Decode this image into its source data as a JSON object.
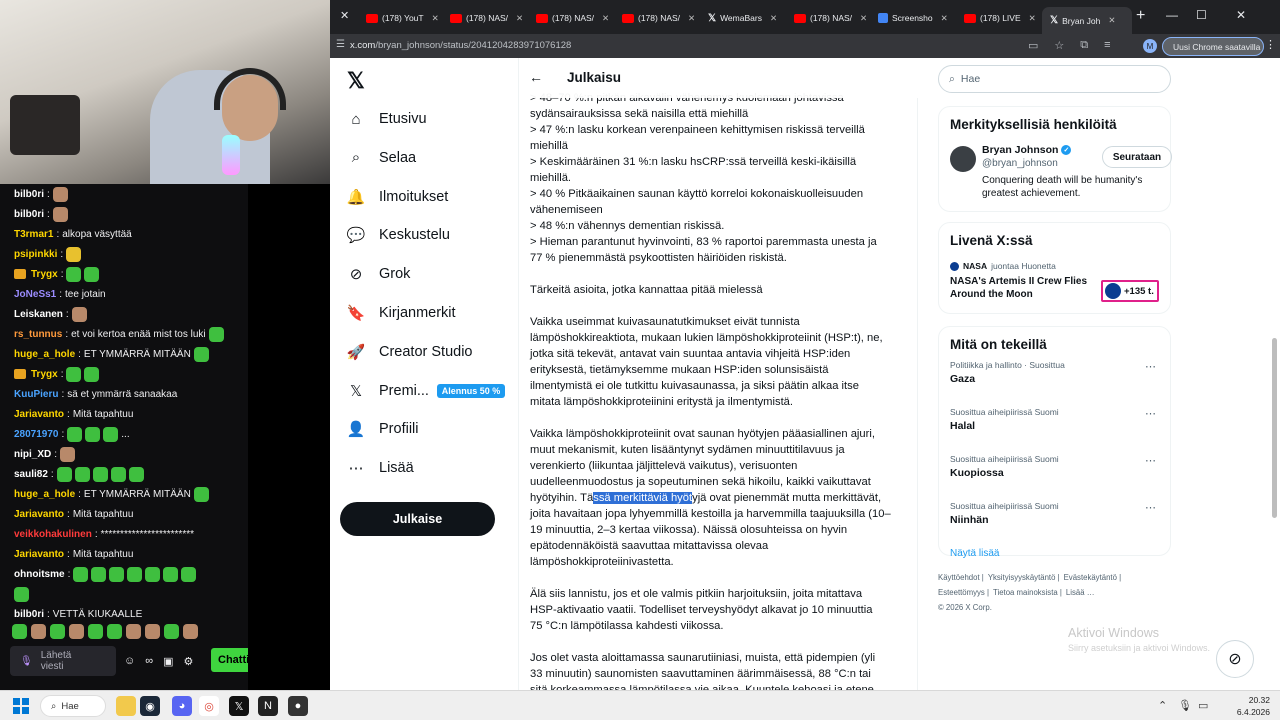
{
  "tabs": [
    {
      "label": "(178) YouT",
      "kind": "yt"
    },
    {
      "label": "(178) NAS/",
      "kind": "yt"
    },
    {
      "label": "(178) NAS/",
      "kind": "yt"
    },
    {
      "label": "(178) NAS/",
      "kind": "yt"
    },
    {
      "label": "WemaBars",
      "kind": "x"
    },
    {
      "label": "(178) NAS/",
      "kind": "yt"
    },
    {
      "label": "Screensho",
      "kind": "doc"
    },
    {
      "label": "(178) LIVE",
      "kind": "yt"
    },
    {
      "label": "Bryan Joh",
      "kind": "x",
      "active": true
    }
  ],
  "address": {
    "host": "x.com",
    "path": "/bryan_johnson/status/2041204283971076128"
  },
  "chrome_update": "Uusi Chrome saatavilla",
  "nav": {
    "logo": "𝕏",
    "items": [
      {
        "label": "Etusivu",
        "icon": "⌂"
      },
      {
        "label": "Selaa",
        "icon": "⌕"
      },
      {
        "label": "Ilmoitukset",
        "icon": "🔔"
      },
      {
        "label": "Keskustelu",
        "icon": "💬"
      },
      {
        "label": "Grok",
        "icon": "⊘"
      },
      {
        "label": "Kirjanmerkit",
        "icon": "🔖"
      },
      {
        "label": "Creator Studio",
        "icon": "🚀"
      },
      {
        "label": "Premi...",
        "icon": "𝕏"
      },
      {
        "label": "Profiili",
        "icon": "👤"
      },
      {
        "label": "Lisää",
        "icon": "⋯"
      }
    ],
    "promo": "Alennus 50 %",
    "post_button": "Julkaise"
  },
  "main": {
    "title": "Julkaisu",
    "lines": [
      "> 48–70 %:n pitkän aikavälin vähenemys kuolemaan johtavissa",
      "sydänsairauksissa sekä naisilla että miehillä",
      "> 47 %:n lasku korkean verenpaineen kehittymisen riskissä terveillä",
      "miehillä",
      "> Keskimääräinen 31 %:n lasku hsCRP:ssä terveillä keski-ikäisillä",
      "miehillä.",
      "> 40 % Pitkäaikainen saunan käyttö korreloi kokonaiskuolleisuuden",
      "vähenemiseen",
      "> 48 %:n vähennys dementian riskissä.",
      "> Hieman parantunut hyvinvointi, 83 % raportoi paremmasta unesta ja",
      "77 % pienemmästä psykoottisten häiriöiden riskistä.",
      "",
      "Tärkeitä asioita, jotka kannattaa pitää mielessä",
      "",
      "Vaikka useimmat kuivasaunatutkimukset eivät tunnista",
      "lämpöshokkireaktiota, mukaan lukien lämpöshokkiproteiinit (HSP:t), ne,",
      "jotka sitä tekevät, antavat vain suuntaa antavia vihjeitä HSP:iden",
      "erityksestä, tietämyksemme mukaan HSP:iden solunsisäistä",
      "ilmentymistä ei ole tutkittu kuivasaunassa, ja siksi päätin alkaa itse",
      "mitata lämpöshokkiproteiinini eritystä ja ilmentymistä.",
      "",
      "Vaikka lämpöshokkiproteiinit ovat saunan hyötyjen pääasiallinen ajuri,",
      "muut mekanismit, kuten lisääntynyt sydämen minuuttitilavuus ja",
      "verenkierto (liikuntaa jäljittelevä vaikutus), verisuonten",
      "uudelleenmuodostus ja sopeutuminen sekä hikoilu, kaikki vaikuttavat"
    ],
    "hl_pre": "hyötyihin. Tä",
    "hl_text": "ssä merkittäviä hyöt",
    "hl_post": "yjä ovat pienemmät mutta merkittävät,",
    "lines2": [
      "joita havaitaan jopa lyhyemmillä kestoilla ja harvemmilla taajuuksilla (10–",
      "19 minuuttia, 2–3 kertaa viikossa). Näissä olosuhteissa on hyvin",
      "epätodennäköistä saavuttaa mitattavissa olevaa",
      "lämpöshokkiproteiinivastetta.",
      "",
      "Älä siis lannistu, jos et ole valmis pitkiin harjoituksiin, joita mitattava",
      "HSP-aktivaatio vaatii. Todelliset terveyshyödyt alkavat jo 10 minuuttia",
      "75 °C:n lämpötilassa kahdesti viikossa.",
      "",
      "Jos olet vasta aloittamassa saunarutiiniasi, muista, että pidempien (yli",
      "33 minuutin) saunomisten saavuttaminen äärimmäisessä, 88 °C:n tai",
      "sitä korkeammassa lämpötilassa vie aikaa. Kuuntele kehoasi ja etene"
    ]
  },
  "right": {
    "search_placeholder": "Hae",
    "people_title": "Merkityksellisiä henkilöitä",
    "person": {
      "name": "Bryan Johnson",
      "handle": "@bryan_johnson",
      "bio": "Conquering death will be humanity's greatest achievement.",
      "follow": "Seurataan"
    },
    "live_title": "Livenä X:ssä",
    "live": {
      "account": "NASA",
      "status": "juontaa Huonetta",
      "title": "NASA's Artemis II Crew Flies Around the Moon",
      "count": "+135 t."
    },
    "trends_title": "Mitä on tekeillä",
    "trends": [
      {
        "meta": "Politiikka ja hallinto · Suosittua",
        "name": "Gaza"
      },
      {
        "meta": "Suosittua aiheipiirissä Suomi",
        "name": "Halal"
      },
      {
        "meta": "Suosittua aiheipiirissä Suomi",
        "name": "Kuopiossa"
      },
      {
        "meta": "Suosittua aiheipiirissä Suomi",
        "name": "Niinhän"
      }
    ],
    "show_more": "Näytä lisää",
    "footer": [
      "Käyttöehdot |",
      "Yksityisyyskäytäntö |",
      "Evästekäytäntö |",
      "Esteettömyys |",
      "Tietoa mainoksista |",
      "Lisää …",
      "© 2026 X Corp."
    ]
  },
  "activate": {
    "title": "Aktivoi Windows",
    "sub": "Siirry asetuksiin ja aktivoi Windows."
  },
  "chat": {
    "messages": [
      {
        "user": "bilb0ri",
        "color": "#ffffff",
        "text": "",
        "emotes": [
          "face"
        ]
      },
      {
        "user": "bilb0ri",
        "color": "#ffffff",
        "text": "",
        "emotes": [
          "face"
        ]
      },
      {
        "user": "T3rmar1",
        "color": "#ffd700",
        "text": "alkopa väsyttää",
        "emotes": []
      },
      {
        "user": "psipinkki",
        "color": "#ffd700",
        "text": "",
        "emotes": [
          "yellow"
        ]
      },
      {
        "user": "Trygx",
        "color": "#ffd700",
        "text": "",
        "emotes": [
          "green",
          "green"
        ],
        "badge": true
      },
      {
        "user": "JoNeSs1",
        "color": "#9b8cff",
        "text": "tee jotain",
        "emotes": []
      },
      {
        "user": "Leiskanen",
        "color": "#ffffff",
        "text": "",
        "emotes": [
          "face"
        ]
      },
      {
        "user": "rs_tunnus",
        "color": "#ff9a3c",
        "text": "et voi kertoa enää mist tos luki",
        "emotes": [
          "green"
        ]
      },
      {
        "user": "huge_a_hole",
        "color": "#ffd700",
        "text": "ET YMMÄRRÄ MITÄÄN",
        "emotes": [
          "green"
        ]
      },
      {
        "user": "Trygx",
        "color": "#ffd700",
        "text": "",
        "emotes": [
          "green",
          "green"
        ],
        "badge": true
      },
      {
        "user": "KuuPieru",
        "color": "#4aa3ff",
        "text": "sä et ymmärrä sanaakaa",
        "emotes": []
      },
      {
        "user": "Jariavanto",
        "color": "#ffd700",
        "text": "Mitä tapahtuu",
        "emotes": []
      },
      {
        "user": "28071970",
        "color": "#4aa3ff",
        "text": "...",
        "emotes": [
          "green",
          "green",
          "green"
        ]
      },
      {
        "user": "nipi_XD",
        "color": "#ffffff",
        "text": "",
        "emotes": [
          "face"
        ]
      },
      {
        "user": "sauli82",
        "color": "#ffffff",
        "text": "",
        "emotes": [
          "green",
          "green",
          "green",
          "green",
          "green"
        ]
      },
      {
        "user": "huge_a_hole",
        "color": "#ffd700",
        "text": "ET YMMÄRRÄ MITÄÄN",
        "emotes": [
          "green"
        ]
      },
      {
        "user": "Jariavanto",
        "color": "#ffd700",
        "text": "Mitä tapahtuu",
        "emotes": []
      },
      {
        "user": "veikkohakulinen",
        "color": "#ff3b3b",
        "text": "************************",
        "emotes": []
      },
      {
        "user": "Jariavanto",
        "color": "#ffd700",
        "text": "Mitä tapahtuu",
        "emotes": []
      },
      {
        "user": "ohnoitsme",
        "color": "#ffffff",
        "text": "",
        "emotes": [
          "green",
          "green",
          "green",
          "green",
          "green",
          "green",
          "green"
        ]
      },
      {
        "user": "",
        "color": "#ffffff",
        "text": "",
        "emotes": [
          "green"
        ]
      },
      {
        "user": "bilb0ri",
        "color": "#ffffff",
        "text": "VETTÄ KIUKAALLE",
        "emotes": []
      }
    ],
    "input_placeholder": "Lähetä viesti",
    "send": "Chatti"
  },
  "taskbar": {
    "search": "Hae",
    "time": "20.32",
    "date": "6.4.2026"
  }
}
